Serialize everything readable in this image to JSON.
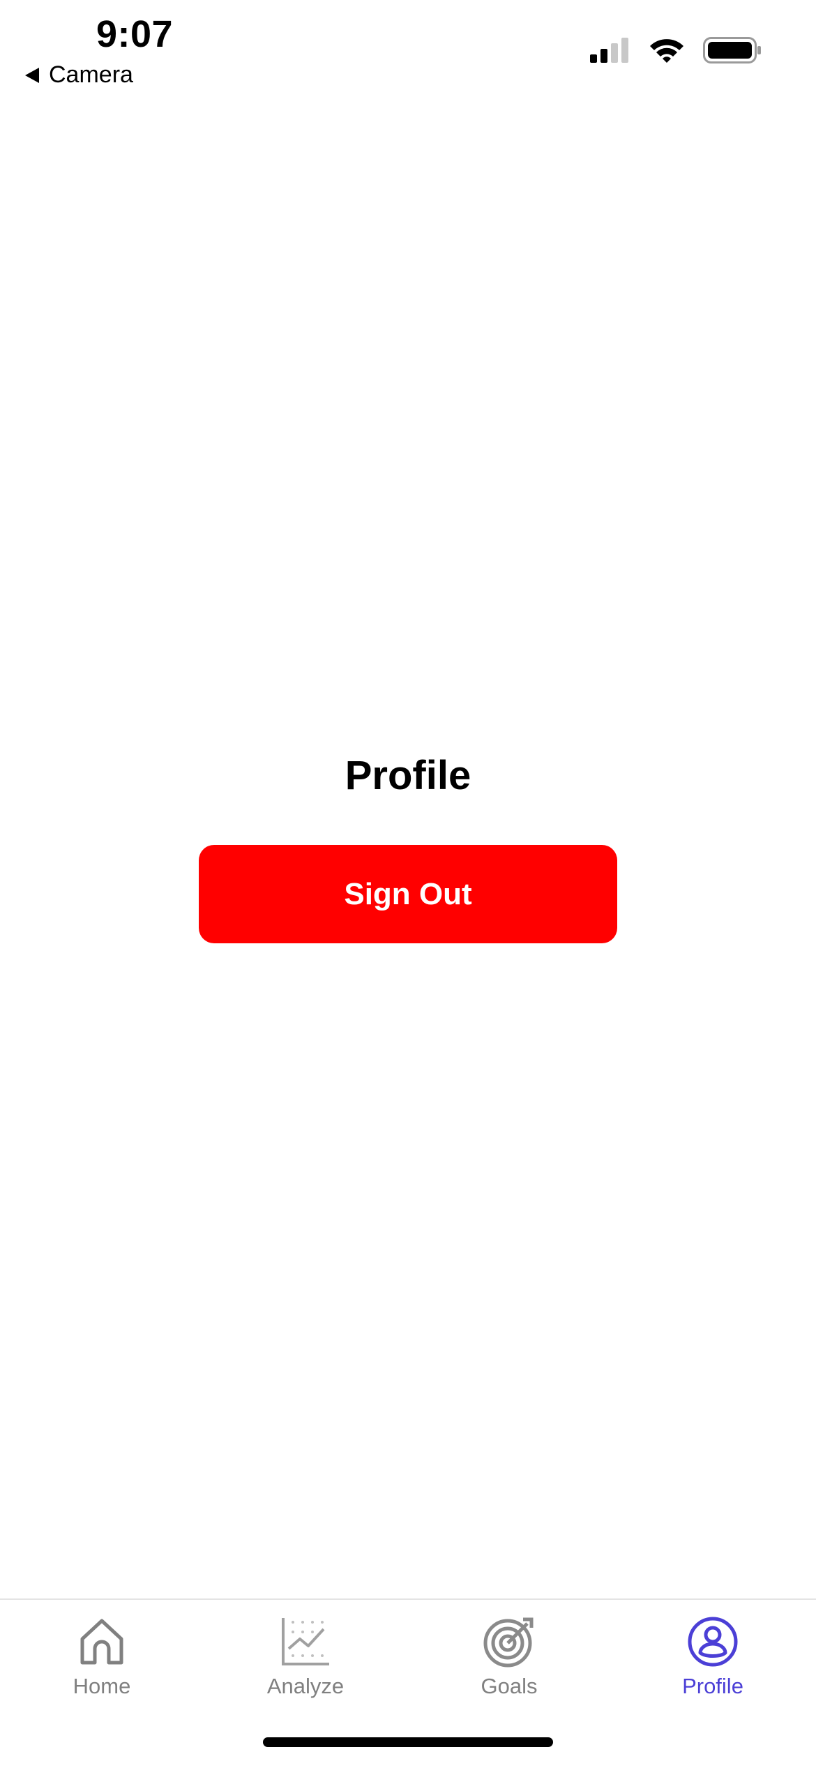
{
  "status_bar": {
    "time": "9:07",
    "back_label": "Camera"
  },
  "main": {
    "title": "Profile",
    "sign_out_label": "Sign Out"
  },
  "tab_bar": {
    "tabs": [
      {
        "label": "Home",
        "icon": "home-icon",
        "active": false
      },
      {
        "label": "Analyze",
        "icon": "chart-icon",
        "active": false
      },
      {
        "label": "Goals",
        "icon": "target-icon",
        "active": false
      },
      {
        "label": "Profile",
        "icon": "profile-icon",
        "active": true
      }
    ]
  },
  "colors": {
    "accent": "#4b3fd6",
    "danger": "#ff0000",
    "inactive": "#808080"
  }
}
